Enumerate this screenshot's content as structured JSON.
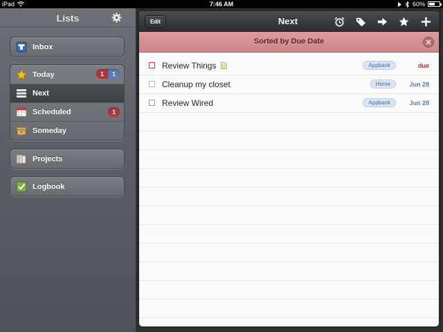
{
  "statusbar": {
    "device": "iPad",
    "time": "7:46 AM",
    "battery": "60%",
    "battery_level": 0.6
  },
  "sidebar": {
    "title": "Lists",
    "groups": [
      {
        "items": [
          {
            "label": "Inbox",
            "icon": "inbox-icon"
          }
        ]
      },
      {
        "items": [
          {
            "label": "Today",
            "icon": "star-icon",
            "badge_due": "1",
            "badge_count": "1"
          },
          {
            "label": "Next",
            "icon": "next-list-icon",
            "selected": true
          },
          {
            "label": "Scheduled",
            "icon": "calendar-icon",
            "badge_due": "1"
          },
          {
            "label": "Someday",
            "icon": "box-icon"
          }
        ]
      },
      {
        "items": [
          {
            "label": "Projects",
            "icon": "projects-icon"
          }
        ]
      },
      {
        "items": [
          {
            "label": "Logbook",
            "icon": "logbook-icon"
          }
        ]
      }
    ]
  },
  "toolbar": {
    "edit_label": "Edit",
    "title": "Next",
    "icons": [
      "alarm-icon",
      "tag-icon",
      "move-arrow-icon",
      "star-icon",
      "add-icon"
    ]
  },
  "sortbar": {
    "label": "Sorted by Due Date"
  },
  "tasks": [
    {
      "title": "Review Things",
      "has_note": true,
      "tag": "Appbank",
      "due": "due",
      "checkbox_color": "#d0323a"
    },
    {
      "title": "Cleanup my closet",
      "has_note": false,
      "tag": "Home",
      "due": "Jun 28",
      "checkbox_color": "#d7c21c"
    },
    {
      "title": "Review Wired",
      "has_note": false,
      "tag": "Appbank",
      "due": "Jun 28",
      "checkbox_color": "#9a9a9a"
    }
  ],
  "colors": {
    "sidebar_bg": "#5c6065",
    "toolbar_bg": "#2b2d2f",
    "sortbar_bg": "#d4898b",
    "overdue": "#c0262b",
    "date": "#5a7db0",
    "badge_red": "#b4343a",
    "badge_blue": "#5d7bb9"
  }
}
